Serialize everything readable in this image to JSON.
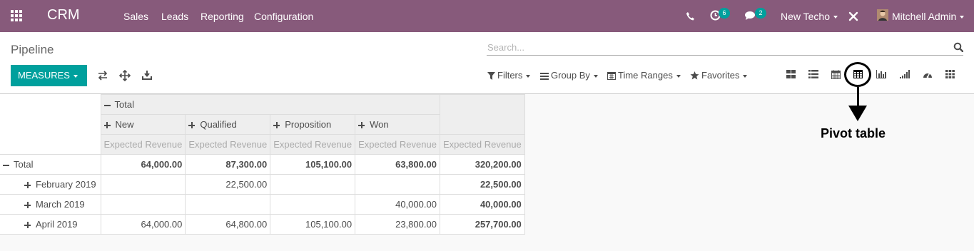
{
  "navbar": {
    "brand": "CRM",
    "menu": [
      "Sales",
      "Leads",
      "Reporting",
      "Configuration"
    ],
    "activity_count": "6",
    "message_count": "2",
    "company": "New Techo",
    "user": "Mitchell Admin",
    "bg_color": "#875a7b",
    "badge_color": "#00a09d"
  },
  "control": {
    "breadcrumb": "Pipeline",
    "search_placeholder": "Search...",
    "measures_label": "MEASURES",
    "filters": [
      "Filters",
      "Group By",
      "Time Ranges",
      "Favorites"
    ],
    "views": [
      "kanban-icon",
      "list-icon",
      "calendar-icon",
      "pivot-icon",
      "graph-icon",
      "cohort-icon",
      "dashboard-icon",
      "activity-icon"
    ],
    "accent": "#00a09d"
  },
  "pivot": {
    "col_total": "Total",
    "columns": [
      "New",
      "Qualified",
      "Proposition",
      "Won"
    ],
    "measure": "Expected Revenue",
    "row_total": "Total",
    "total_row": [
      "64,000.00",
      "87,300.00",
      "105,100.00",
      "63,800.00",
      "320,200.00"
    ],
    "rows": [
      {
        "label": "February 2019",
        "values": [
          "",
          "22,500.00",
          "",
          "",
          "22,500.00"
        ]
      },
      {
        "label": "March 2019",
        "values": [
          "",
          "",
          "",
          "40,000.00",
          "40,000.00"
        ]
      },
      {
        "label": "April 2019",
        "values": [
          "64,000.00",
          "64,800.00",
          "105,100.00",
          "23,800.00",
          "257,700.00"
        ]
      }
    ]
  },
  "annotation": {
    "label": "Pivot table"
  }
}
